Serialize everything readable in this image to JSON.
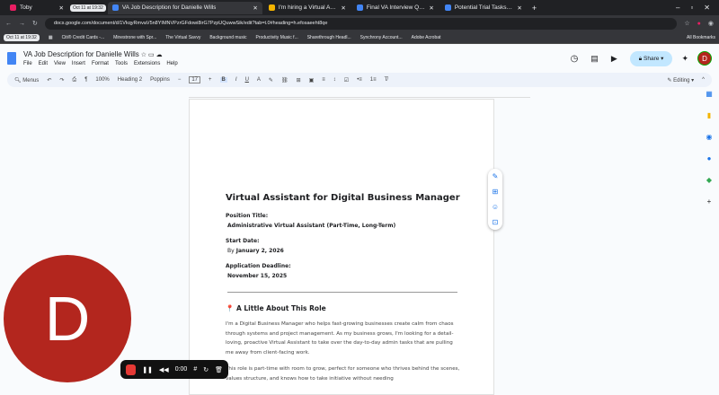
{
  "browser": {
    "clock": "Oct 11 at 19:32",
    "tabs": [
      {
        "label": "Toby",
        "color": "#e91e63"
      },
      {
        "label": "VA Job Description for Danielle Wills",
        "color": "#4285f4",
        "active": true
      },
      {
        "label": "I'm hiring a Virtual Assistant",
        "color": "#f4b400"
      },
      {
        "label": "Final VA Interview Questions -",
        "color": "#4285f4"
      },
      {
        "label": "Potential Trial Tasks for VA Pos",
        "color": "#4285f4"
      }
    ],
    "url": "docs.google.com/document/d/1VkqyRmvaV5n8YIMNVPzrGFdowi8irG7PzpUQuwwSik/edit?tab=t.0#heading=h.efosaeeht8qe",
    "bookmarks": [
      "Citi® Credit Cards -...",
      "Minestrone with Spr...",
      "The Virtual Savvy",
      "Background music",
      "Productivity Music f...",
      "Sharethrough Headl...",
      "Synchrony Account...",
      "Adobe Acrobat"
    ],
    "all_bookmarks": "All Bookmarks"
  },
  "docs": {
    "title": "VA Job Description for Danielle Wills",
    "menus": [
      "File",
      "Edit",
      "View",
      "Insert",
      "Format",
      "Tools",
      "Extensions",
      "Help"
    ],
    "share": "Share",
    "avatar": "D",
    "toolbar": {
      "menus": "Menus",
      "zoom": "100%",
      "style": "Heading 2",
      "font": "Poppins",
      "size": "17",
      "mode": "Editing"
    }
  },
  "doc": {
    "heading": "Virtual Assistant for Digital Business Manager",
    "position_label": "Position Title:",
    "position_value": "Administrative Virtual Assistant (Part-Time, Long-Term)",
    "start_label": "Start Date:",
    "start_prefix": "By",
    "start_value": "January 2, 2026",
    "deadline_label": "Application Deadline:",
    "deadline_value": "November 15, 2025",
    "section_icon": "📍",
    "section_title": "A Little About This Role",
    "para1": "I'm a Digital Business Manager who helps fast-growing businesses create calm from chaos through systems and project management. As my business grows, I'm looking for a detail-loving, proactive Virtual Assistant to take over the day-to-day admin tasks that are pulling me away from client-facing work.",
    "para2": "This role is part-time with room to grow, perfect for someone who thrives behind the scenes, values structure, and knows how to take initiative without needing"
  },
  "overlay": {
    "avatar": "D",
    "timer": "0:00"
  }
}
